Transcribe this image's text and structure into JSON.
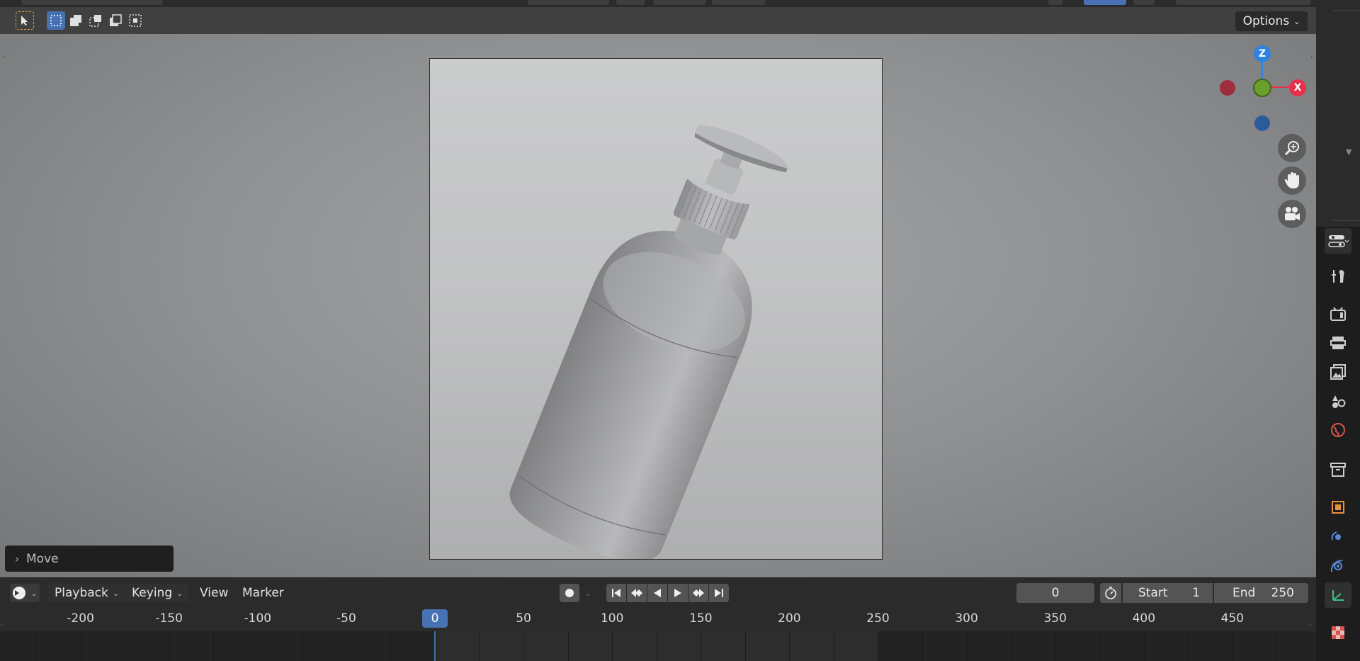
{
  "viewport": {
    "options_label": "Options",
    "tools": [
      "tweak-select-tool-icon",
      "box-select-icon",
      "extend-selection-icon",
      "subtract-selection-icon",
      "invert-selection-icon",
      "intersect-selection-icon"
    ],
    "gizmo": {
      "z_label": "Z",
      "x_label": "X",
      "x_color": "#e8304b",
      "y_color": "#6b9e2d",
      "z_color": "#2f83e0",
      "negative_x_color": "#9e2e3c",
      "negative_z_color": "#2b5c99"
    },
    "navigation": [
      "zoom-icon",
      "pan-hand-icon",
      "camera-view-icon"
    ],
    "last_operation": "Move"
  },
  "properties_tabs": [
    "editor-type-icon",
    "tool-settings-icon",
    "render-icon",
    "output-icon",
    "view-layer-icon",
    "scene-icon",
    "world-icon",
    "collection-icon",
    "object-icon",
    "modifiers-icon",
    "physics-icon",
    "object-data-icon",
    "texture-icon"
  ],
  "timeline": {
    "menus": {
      "playback": "Playback",
      "keying": "Keying",
      "view": "View",
      "marker": "Marker"
    },
    "current_frame": "0",
    "start_label": "Start",
    "start_value": "1",
    "end_label": "End",
    "end_value": "250",
    "ruler_labels": [
      "-200",
      "-150",
      "-100",
      "-50",
      "0",
      "50",
      "100",
      "150",
      "200",
      "250",
      "300",
      "350",
      "400",
      "450"
    ],
    "playhead_frame": "0",
    "accent_color": "#4772b3"
  }
}
